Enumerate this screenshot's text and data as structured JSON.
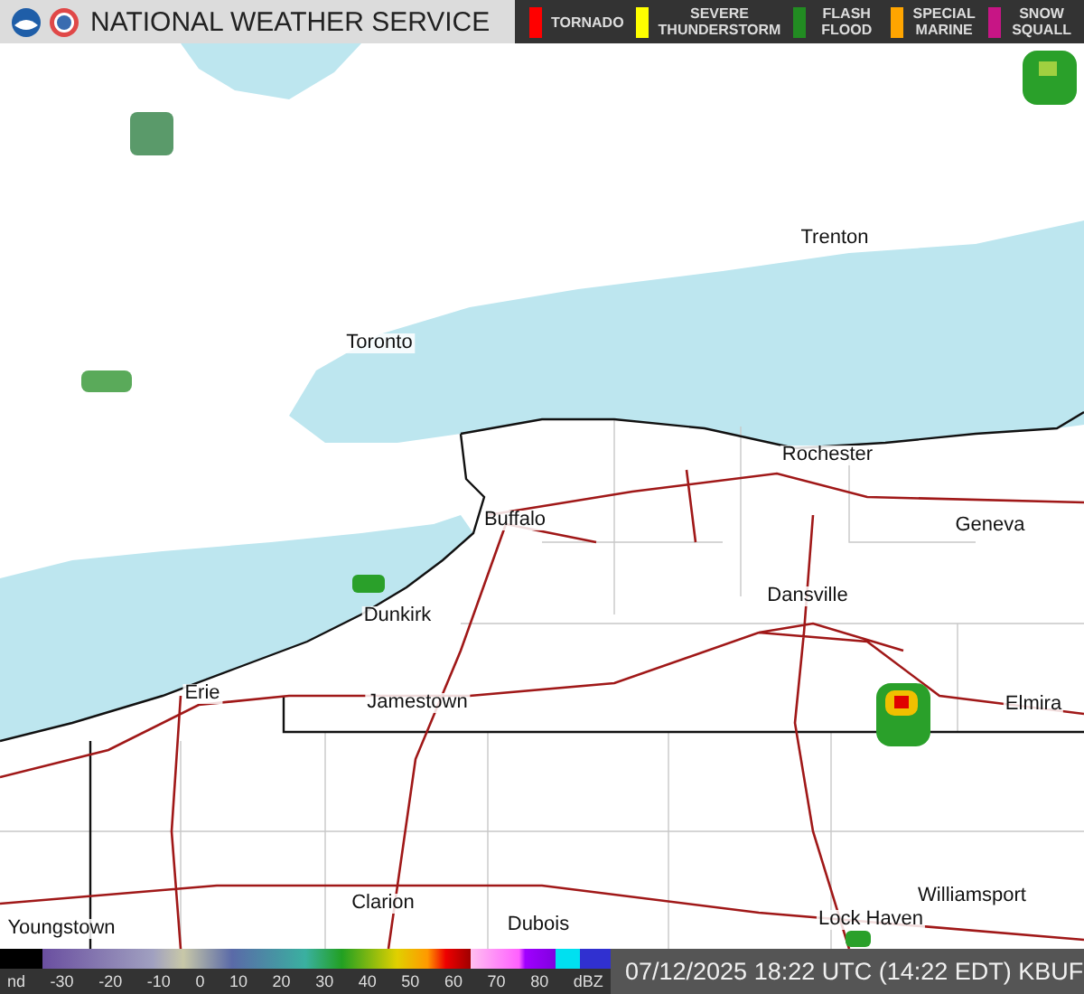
{
  "header": {
    "title": "NATIONAL WEATHER SERVICE"
  },
  "warnings": [
    {
      "label": "TORNADO",
      "color": "#ff0000"
    },
    {
      "label": "SEVERE THUNDERSTORM",
      "color": "#ffff00"
    },
    {
      "label": "FLASH FLOOD",
      "color": "#228b22"
    },
    {
      "label": "SPECIAL MARINE",
      "color": "#ffa500"
    },
    {
      "label": "SNOW SQUALL",
      "color": "#c71585"
    }
  ],
  "cities": [
    "Trenton",
    "Toronto",
    "Rochester",
    "Buffalo",
    "Geneva",
    "Dunkirk",
    "Dansville",
    "Jamestown",
    "Erie",
    "Elmira",
    "Youngstown",
    "Clarion",
    "Dubois",
    "Lock Haven",
    "Williamsport"
  ],
  "legend": {
    "ticks": [
      "nd",
      "-30",
      "-20",
      "-10",
      "0",
      "10",
      "20",
      "30",
      "40",
      "50",
      "60",
      "70",
      "80",
      "dBZ"
    ]
  },
  "timestamp": "07/12/2025 18:22 UTC (14:22 EDT) KBUF"
}
